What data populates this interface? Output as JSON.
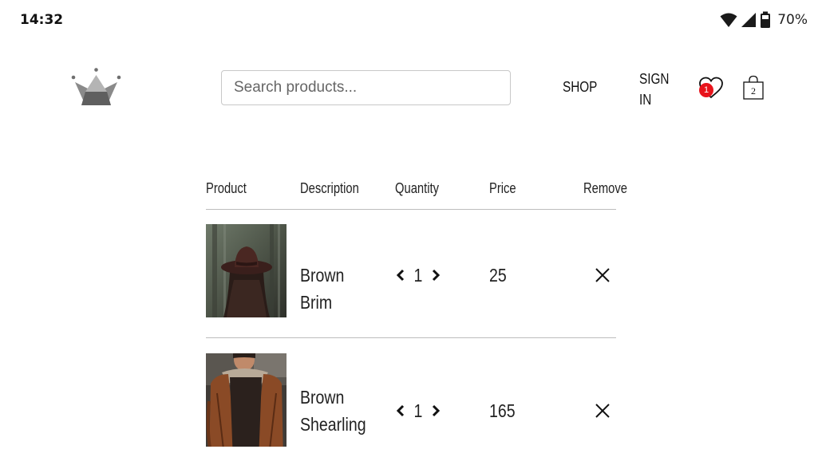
{
  "status_bar": {
    "time": "14:32",
    "battery": "70%"
  },
  "header": {
    "search_placeholder": "Search products...",
    "nav_shop": "SHOP",
    "nav_signin_line1": "SIGN",
    "nav_signin_line2": "IN",
    "wishlist_count": "1",
    "cart_count": "2"
  },
  "cart": {
    "columns": [
      "Product",
      "Description",
      "Quantity",
      "Price",
      "Remove"
    ],
    "items": [
      {
        "description": "Brown Brim",
        "quantity": "1",
        "price": "25",
        "image": "hat-photo"
      },
      {
        "description_line1": "Brown",
        "description_line2": "Shearling",
        "quantity": "1",
        "price": "165",
        "image": "jacket-photo"
      }
    ]
  },
  "colors": {
    "badge": "#e8141c",
    "divider": "#bdbdbd",
    "logo": "#6f6f6f"
  }
}
